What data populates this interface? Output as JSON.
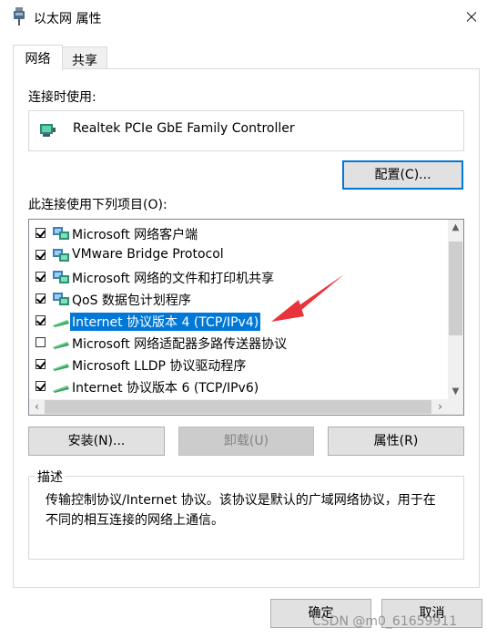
{
  "window": {
    "title": "以太网 属性",
    "close_icon": "close-icon"
  },
  "tabs": [
    {
      "label": "网络",
      "active": true
    },
    {
      "label": "共享",
      "active": false
    }
  ],
  "connect_using": {
    "label": "连接时使用:",
    "adapter": "Realtek PCIe GbE Family Controller"
  },
  "configure_button": "配置(C)...",
  "items_label": "此连接使用下列项目(O):",
  "items": [
    {
      "label": "Microsoft 网络客户端",
      "checked": true,
      "icon": "network-client-icon"
    },
    {
      "label": "VMware Bridge Protocol",
      "checked": true,
      "icon": "network-service-icon"
    },
    {
      "label": "Microsoft 网络的文件和打印机共享",
      "checked": true,
      "icon": "network-service-icon"
    },
    {
      "label": "QoS 数据包计划程序",
      "checked": true,
      "icon": "network-service-icon"
    },
    {
      "label": "Internet 协议版本 4 (TCP/IPv4)",
      "checked": true,
      "selected": true,
      "icon": "protocol-icon"
    },
    {
      "label": "Microsoft 网络适配器多路传送器协议",
      "checked": false,
      "icon": "protocol-icon"
    },
    {
      "label": "Microsoft LLDP 协议驱动程序",
      "checked": true,
      "icon": "protocol-icon"
    },
    {
      "label": "Internet 协议版本 6 (TCP/IPv6)",
      "checked": true,
      "icon": "protocol-icon"
    }
  ],
  "buttons": {
    "install": "安装(N)...",
    "uninstall": "卸载(U)",
    "properties": "属性(R)",
    "ok": "确定",
    "cancel": "取消"
  },
  "description": {
    "legend": "描述",
    "text": "传输控制协议/Internet 协议。该协议是默认的广域网络协议，用于在不同的相互连接的网络上通信。"
  },
  "watermark": "CSDN @m0_61659911",
  "colors": {
    "selection": "#0078d7",
    "annotation_arrow": "#e8333b"
  }
}
